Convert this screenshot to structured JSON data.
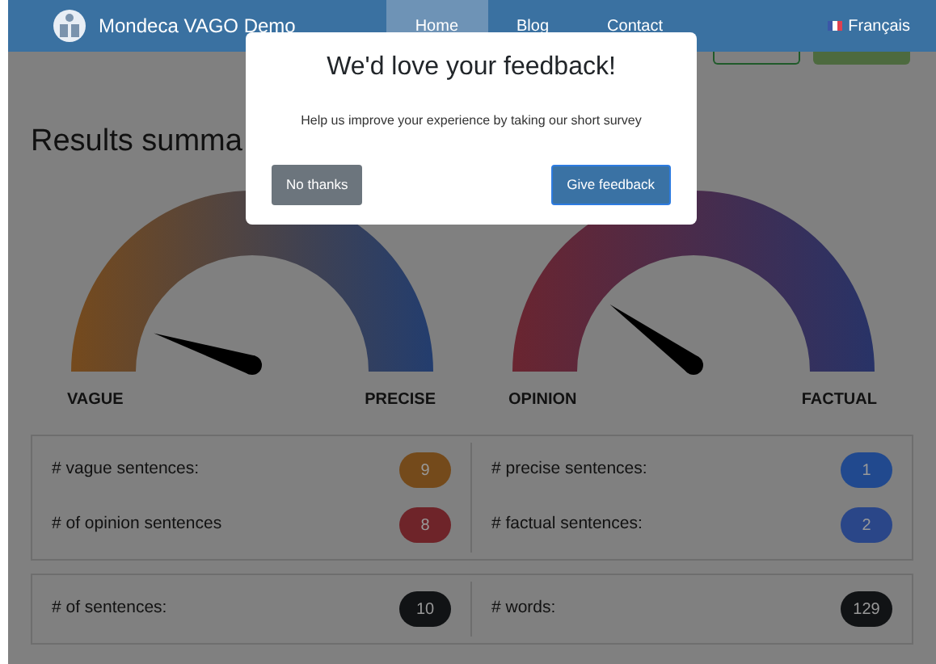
{
  "navbar": {
    "brand": "Mondeca VAGO Demo",
    "links": [
      {
        "label": "Home",
        "selected": true
      },
      {
        "label": "Blog",
        "selected": false
      },
      {
        "label": "Contact",
        "selected": false
      }
    ],
    "language": "Français"
  },
  "heading": "Results summa",
  "gauges": [
    {
      "left_label": "VAGUE",
      "right_label": "PRECISE"
    },
    {
      "left_label": "OPINION",
      "right_label": "FACTUAL"
    }
  ],
  "stat_groups": [
    {
      "items": [
        {
          "label": "# vague sentences:",
          "value": "9",
          "color": "#744a1b"
        },
        {
          "label": "# precise sentences:",
          "value": "1",
          "color": "#21498e"
        },
        {
          "label": "# of opinion sentences",
          "value": "8",
          "color": "#6e2429"
        },
        {
          "label": "# factual sentences:",
          "value": "2",
          "color": "#2a4688"
        }
      ]
    },
    {
      "items": [
        {
          "label": "# of sentences:",
          "value": "10",
          "color": "#111315"
        },
        {
          "label": "# words:",
          "value": "129",
          "color": "#111315"
        }
      ]
    }
  ],
  "modal": {
    "title": "We'd love your feedback!",
    "message": "Help us improve your experience by taking our short survey",
    "buttons": [
      {
        "label": "No thanks",
        "kind": "secondary"
      },
      {
        "label": "Give feedback",
        "kind": "primary"
      }
    ]
  }
}
